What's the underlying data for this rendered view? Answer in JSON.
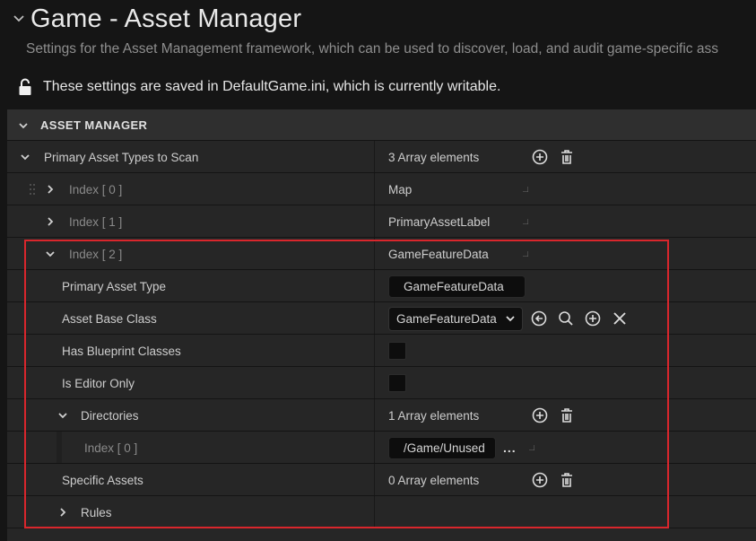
{
  "header": {
    "title": "Game - Asset Manager",
    "subtitle": "Settings for the Asset Management framework, which can be used to discover, load, and audit game-specific ass",
    "writable_note": "These settings are saved in DefaultGame.ini, which is currently writable."
  },
  "section": {
    "label": "ASSET MANAGER"
  },
  "primary_asset_types": {
    "label": "Primary Asset Types to Scan",
    "count": "3 Array elements",
    "items": [
      {
        "label": "Index [ 0 ]",
        "value": "Map"
      },
      {
        "label": "Index [ 1 ]",
        "value": "PrimaryAssetLabel"
      },
      {
        "label": "Index [ 2 ]",
        "value": "GameFeatureData"
      }
    ]
  },
  "index2_details": {
    "primary_asset_type": {
      "label": "Primary Asset Type",
      "value": "GameFeatureData"
    },
    "asset_base_class": {
      "label": "Asset Base Class",
      "value": "GameFeatureData"
    },
    "has_blueprint_classes": {
      "label": "Has Blueprint Classes",
      "checked": false
    },
    "is_editor_only": {
      "label": "Is Editor Only",
      "checked": false
    },
    "directories": {
      "label": "Directories",
      "count": "1 Array elements",
      "items": [
        {
          "label": "Index [ 0 ]",
          "value": "/Game/Unused",
          "browse": "..."
        }
      ]
    },
    "specific_assets": {
      "label": "Specific Assets",
      "count": "0 Array elements"
    },
    "rules": {
      "label": "Rules"
    }
  },
  "colors": {
    "highlight": "#d9262c",
    "background": "#262626",
    "section": "#2f2f2f"
  }
}
